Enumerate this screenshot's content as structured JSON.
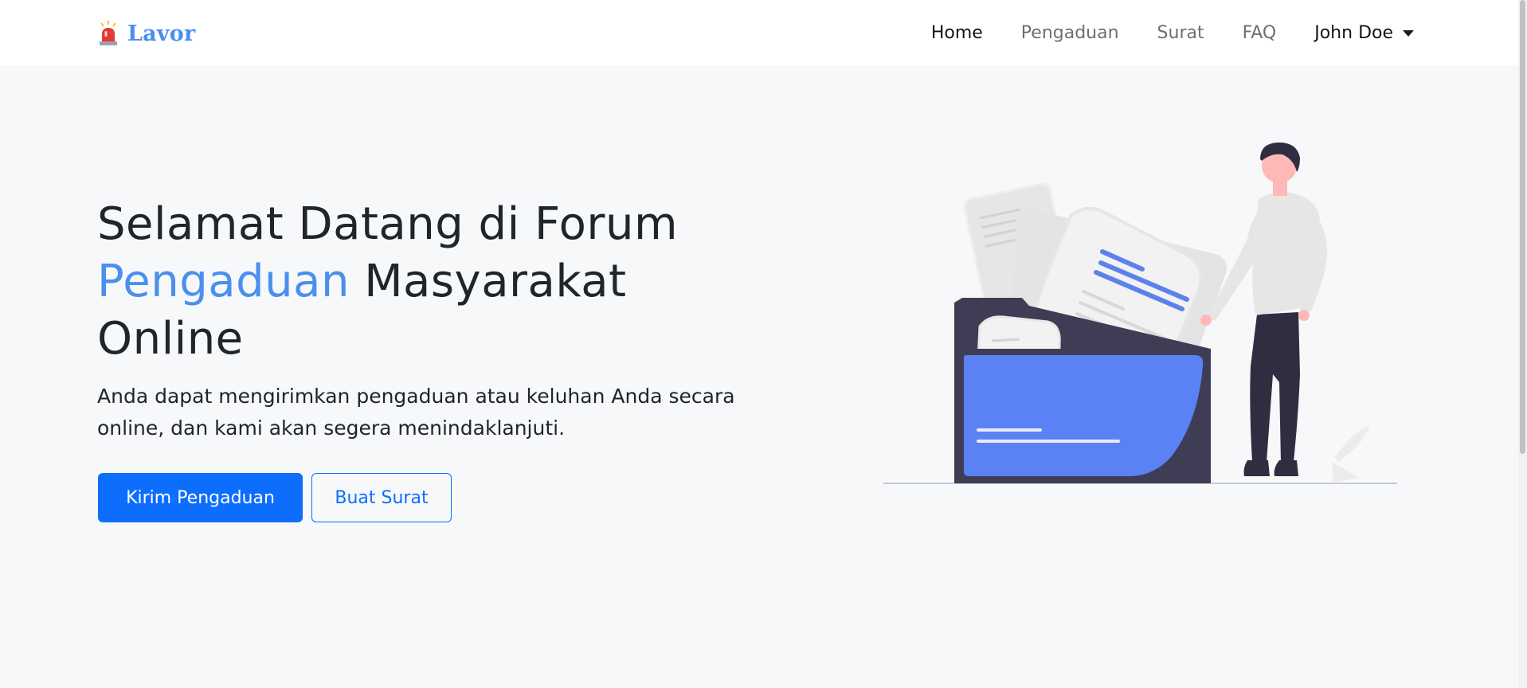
{
  "brand": {
    "name": "Lavor",
    "icon": "siren-icon",
    "color": "#4a8ff0"
  },
  "nav": {
    "items": [
      {
        "label": "Home",
        "active": true
      },
      {
        "label": "Pengaduan",
        "active": false
      },
      {
        "label": "Surat",
        "active": false
      },
      {
        "label": "FAQ",
        "active": false
      }
    ],
    "user": {
      "name": "John Doe",
      "icon": "caret-down-icon"
    }
  },
  "hero": {
    "title_part1": "Selamat Datang di Forum ",
    "title_accent": "Pengaduan",
    "title_part2": " Masyarakat Online",
    "subtitle": "Anda dapat mengirimkan pengaduan atau keluhan Anda secara online, dan kami akan segera menindaklanjuti.",
    "primary_button": "Kirim Pengaduan",
    "secondary_button": "Buat Surat",
    "illustration": "folder-documents-person-illustration"
  },
  "colors": {
    "accent": "#4a90ec",
    "primary": "#0d6efd",
    "background": "#f7f8fa",
    "navbar": "#ffffff"
  }
}
